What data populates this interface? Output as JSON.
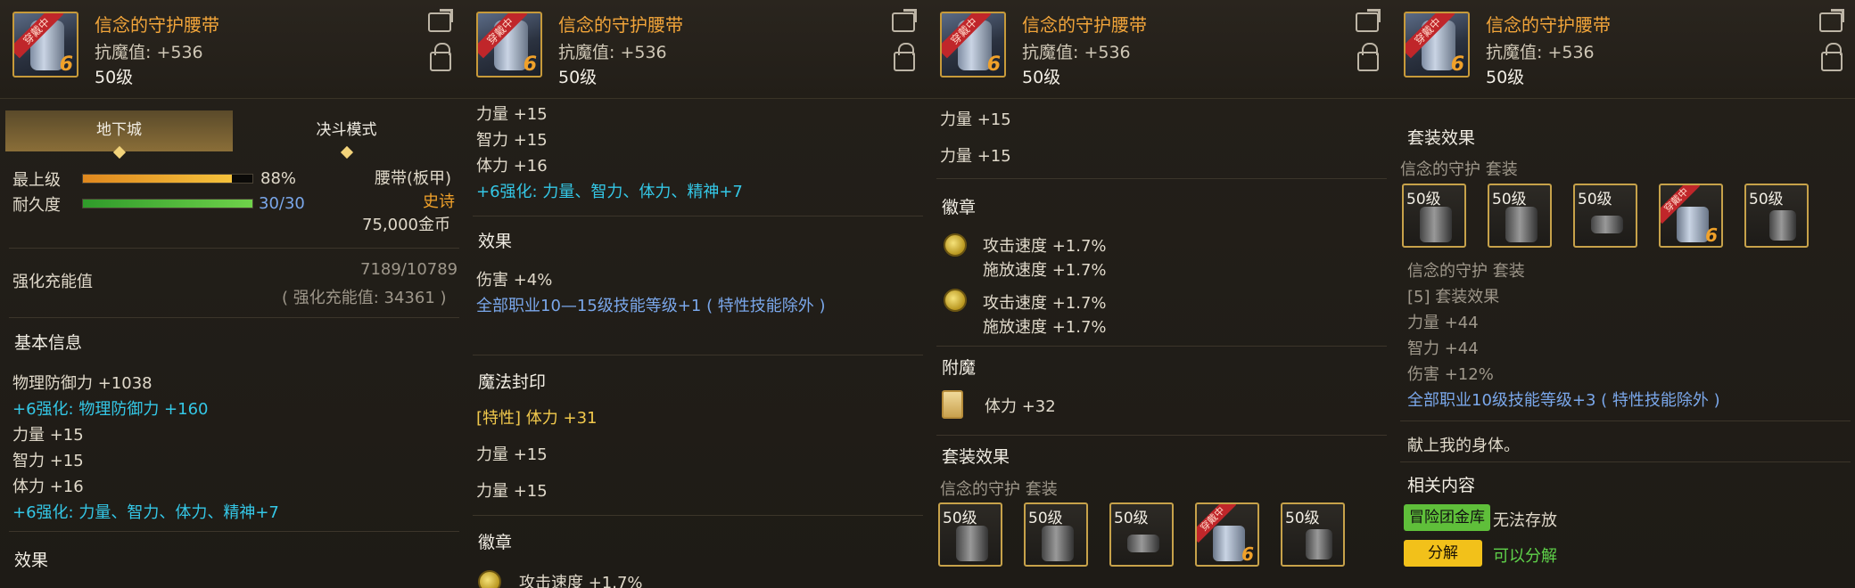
{
  "item": {
    "title": "信念的守护腰带",
    "resist": "抗魔值: +536",
    "level": "50级",
    "equipped_ribbon": "穿戴中",
    "grade": "6"
  },
  "p1": {
    "tabs": [
      "地下城",
      "决斗模式"
    ],
    "max_level_label": "最上级",
    "max_level_pct": "88%",
    "max_level_fraction": 0.88,
    "durability_label": "耐久度",
    "durability": "30/30",
    "durability_fraction": 1.0,
    "slot_type": "腰带(板甲)",
    "rarity": "史诗",
    "price": "75,000金币",
    "charge_label": "强化充能值",
    "charge_value": "7189/10789",
    "charge_total": "( 强化充能值: 34361 )",
    "basic_info": "基本信息",
    "stats": [
      "物理防御力 +1038",
      "+6强化: 物理防御力 +160",
      "力量 +15",
      "智力 +15",
      "体力 +16",
      "+6强化: 力量、智力、体力、精神+7"
    ],
    "effect": "效果"
  },
  "p2": {
    "lines": [
      "力量 +15",
      "智力 +15",
      "体力 +16",
      "+6强化: 力量、智力、体力、精神+7"
    ],
    "effect": "效果",
    "dmg": "伤害 +4%",
    "skill": "全部职业10—15级技能等级+1 ( 特性技能除外 )",
    "seal": "魔法封印",
    "trait": "[特性] 体力 +31",
    "str": "力量 +15",
    "str2": "力量 +15",
    "emblem": "徽章",
    "cut": "攻击速度 +1.7%"
  },
  "p3": {
    "str": "力量 +15",
    "str2": "力量 +15",
    "emblem": "徽章",
    "e1a": "攻击速度 +1.7%",
    "e1b": "施放速度 +1.7%",
    "e2a": "攻击速度 +1.7%",
    "e2b": "施放速度 +1.7%",
    "enchant": "附魔",
    "vit": "体力 +32",
    "set": "套装效果",
    "setname": "信念的守护 套装",
    "slot_level": "50级"
  },
  "p4": {
    "set": "套装效果",
    "setname": "信念的守护 套装",
    "slot_level": "50级",
    "setname2": "信念的守护 套装",
    "bonus": "[5] 套装效果",
    "s1": "力量 +44",
    "s2": "智力 +44",
    "s3": "伤害 +12%",
    "s4": "全部职业10级技能等级+3 ( 特性技能除外 )",
    "quote": "献上我的身体。",
    "related": "相关内容",
    "bank_btn": "冒险团金库",
    "bank_text": "无法存放",
    "dis_btn": "分解",
    "dis_text": "可以分解"
  }
}
